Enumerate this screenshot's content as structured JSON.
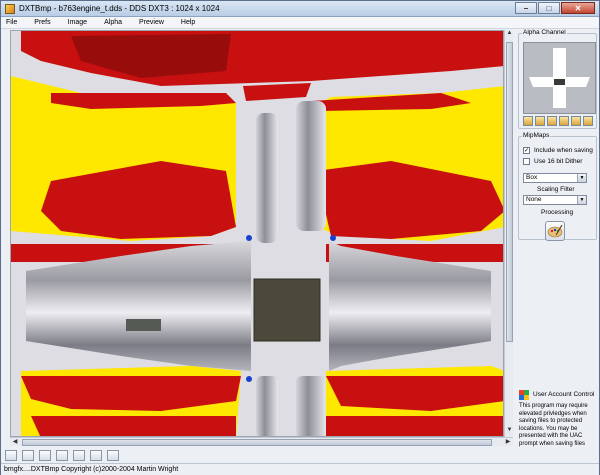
{
  "window": {
    "title": "DXTBmp - b763engine_t.dds - DDS DXT3 : 1024 x 1024",
    "min_glyph": "–",
    "max_glyph": "□",
    "close_glyph": "✕"
  },
  "menu": [
    "File",
    "Prefs",
    "Image",
    "Alpha",
    "Preview",
    "Help"
  ],
  "panel": {
    "alpha_group": "Alpha Channel",
    "mipmaps_group": "MipMaps",
    "include_when_saving": "Include when saving",
    "include_checked": true,
    "use_16bit_dither": "Use 16 bit Dither",
    "dither_checked": false,
    "filter_select": "Box",
    "scaling_filter_label": "Scaling Filter",
    "scaling_select": "None",
    "processing_label": "Processing"
  },
  "uac": {
    "title": "User Account Control",
    "body": "This program may require elevated privledges when saving files to protected locations. You may be presented with the UAC prompt when saving files"
  },
  "status": {
    "text": "bmgfx....DXTBmp Copyright (c)2000-2004 Martin Wright"
  },
  "colors": {
    "red": "#c81010",
    "yellow": "#ffe800",
    "canvas_bg": "#dddde3"
  }
}
